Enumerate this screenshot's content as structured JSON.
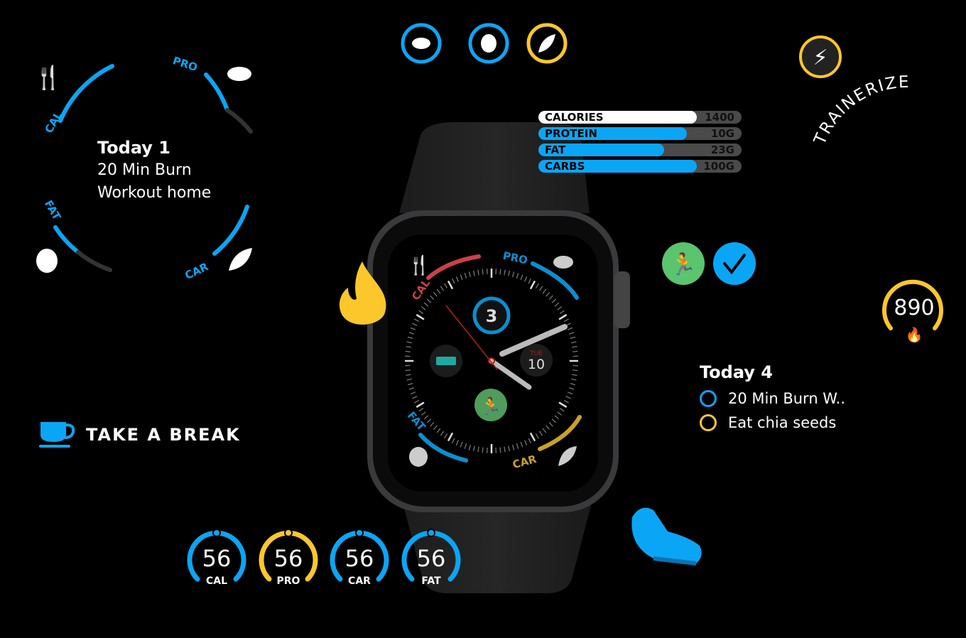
{
  "colors": {
    "blue": "#0aa6f5",
    "yellow": "#fcc72b",
    "green": "#5ac46e",
    "red": "#c8414b",
    "watch_blue": "#0a8fd0",
    "watch_gold": "#c9a227"
  },
  "left_ring": {
    "title": "Today 1",
    "line1": "20 Min Burn",
    "line2": "Workout home",
    "labels": [
      "CAL",
      "PRO",
      "FAT",
      "CAR"
    ],
    "icons": [
      "fork-knife-icon",
      "steak-icon",
      "avocado-icon",
      "corn-icon"
    ]
  },
  "top_icons": [
    {
      "icon": "steak-icon",
      "color": "#0aa6f5"
    },
    {
      "icon": "avocado-icon",
      "color": "#0aa6f5"
    },
    {
      "icon": "corn-icon",
      "color": "#fcc72b"
    }
  ],
  "nutrition_bars": [
    {
      "label": "CALORIES",
      "value": "1400",
      "fraction": 0.78,
      "color": "#ffffff"
    },
    {
      "label": "PROTEIN",
      "value": "10G",
      "fraction": 0.73,
      "color": "#0aa6f5"
    },
    {
      "label": "FAT",
      "value": "23G",
      "fraction": 0.62,
      "color": "#0aa6f5"
    },
    {
      "label": "CARBS",
      "value": "100G",
      "fraction": 0.78,
      "color": "#0aa6f5"
    }
  ],
  "brand": {
    "name": "TRAINERIZE"
  },
  "calorie_gauge": {
    "value": "890"
  },
  "watch": {
    "labels": [
      "CAL",
      "PRO",
      "FAT",
      "CAR"
    ],
    "center_count": "3",
    "day": "TUE",
    "date": "10"
  },
  "today_tasks": {
    "title": "Today  4",
    "items": [
      {
        "text": "20 Min Burn W..",
        "color": "#0aa6f5"
      },
      {
        "text": "Eat chia seeds",
        "color": "#fcc72b"
      }
    ]
  },
  "break": {
    "label": "TAKE A BREAK"
  },
  "small_rings": [
    {
      "value": "56",
      "label": "CAL",
      "color": "#0aa6f5"
    },
    {
      "value": "56",
      "label": "PRO",
      "color": "#fcc72b"
    },
    {
      "value": "56",
      "label": "CAR",
      "color": "#0aa6f5"
    },
    {
      "value": "56",
      "label": "FAT",
      "color": "#0aa6f5"
    }
  ]
}
